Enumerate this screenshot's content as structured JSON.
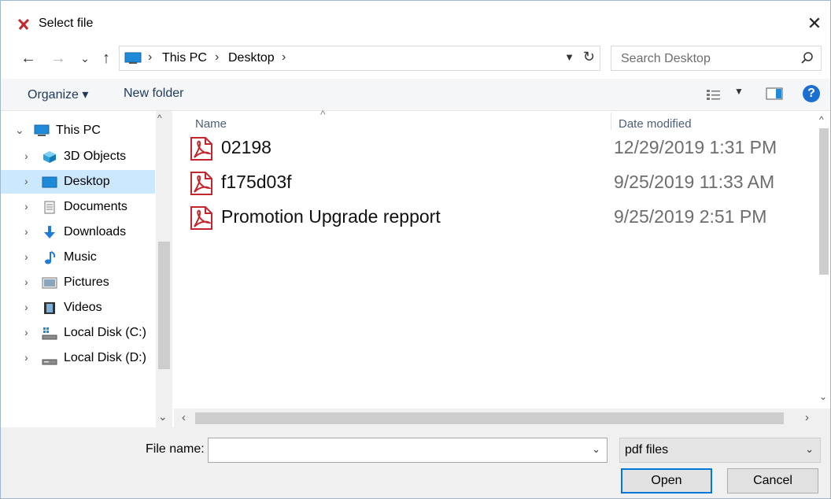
{
  "window": {
    "title": "Select file",
    "close": "✕"
  },
  "nav": {
    "back": "←",
    "forward": "→",
    "recent": "⌄",
    "up": "↑",
    "breadcrumb": [
      "This PC",
      "Desktop"
    ],
    "separator": "›",
    "refresh": "↻",
    "search_placeholder": "Search Desktop"
  },
  "toolbar": {
    "organize": "Organize ▾",
    "new_folder": "New folder",
    "help": "?"
  },
  "sidebar": {
    "items": [
      {
        "label": "This PC",
        "icon": "monitor-icon",
        "expanded": true
      },
      {
        "label": "3D Objects",
        "icon": "cube-icon"
      },
      {
        "label": "Desktop",
        "icon": "desktop-icon",
        "selected": true
      },
      {
        "label": "Documents",
        "icon": "document-icon"
      },
      {
        "label": "Downloads",
        "icon": "download-arrow-icon"
      },
      {
        "label": "Music",
        "icon": "music-note-icon"
      },
      {
        "label": "Pictures",
        "icon": "picture-icon"
      },
      {
        "label": "Videos",
        "icon": "film-icon"
      },
      {
        "label": "Local Disk (C:)",
        "icon": "system-drive-icon"
      },
      {
        "label": "Local Disk (D:)",
        "icon": "drive-icon"
      }
    ]
  },
  "files": {
    "columns": {
      "name": "Name",
      "date": "Date modified"
    },
    "rows": [
      {
        "name": "02198",
        "date": "12/29/2019 1:31 PM",
        "icon": "pdf-icon"
      },
      {
        "name": "f175d03f",
        "date": "9/25/2019 11:33 AM",
        "icon": "pdf-icon"
      },
      {
        "name": "Promotion Upgrade repport",
        "date": "9/25/2019 2:51 PM",
        "icon": "pdf-icon"
      }
    ]
  },
  "footer": {
    "file_name_label": "File name:",
    "file_name_value": "",
    "filter": "pdf files",
    "open": "Open",
    "cancel": "Cancel"
  },
  "colors": {
    "accent": "#0078d7",
    "selection": "#cce8ff",
    "pdf_red": "#c1272d"
  }
}
